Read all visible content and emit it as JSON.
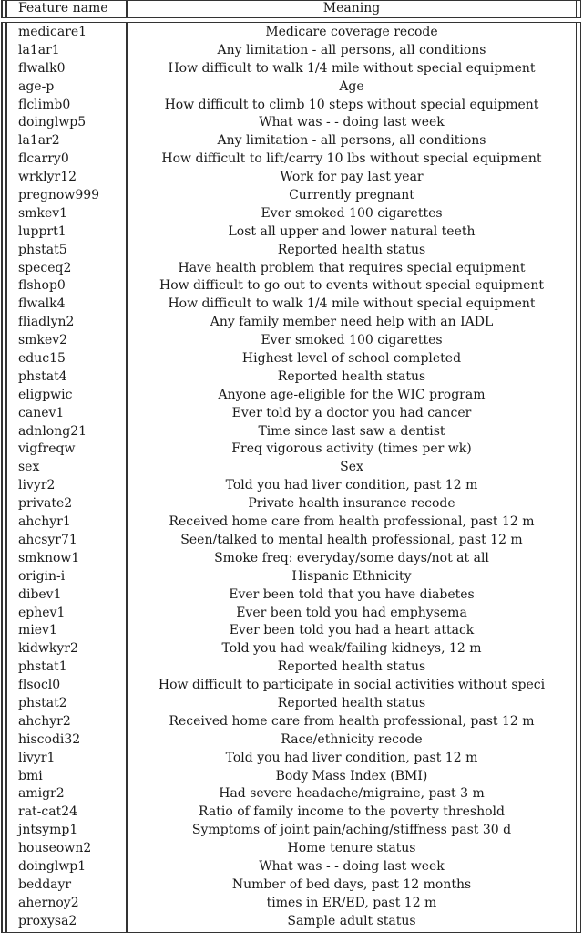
{
  "table": {
    "headers": {
      "feature_name": "Feature name",
      "meaning": "Meaning"
    },
    "rows": [
      {
        "name": "medicare1",
        "meaning": "Medicare coverage recode"
      },
      {
        "name": "la1ar1",
        "meaning": "Any limitation - all persons, all conditions"
      },
      {
        "name": "flwalk0",
        "meaning": "How difficult to walk 1/4 mile without special equipment"
      },
      {
        "name": "age-p",
        "meaning": "Age"
      },
      {
        "name": "flclimb0",
        "meaning": "How difficult to climb 10 steps without special equipment"
      },
      {
        "name": "doinglwp5",
        "meaning": "What was - - doing last week"
      },
      {
        "name": "la1ar2",
        "meaning": "Any limitation - all persons, all conditions"
      },
      {
        "name": "flcarry0",
        "meaning": "How difficult to lift/carry 10 lbs without special equipment"
      },
      {
        "name": "wrklyr12",
        "meaning": "Work for pay last year"
      },
      {
        "name": "pregnow999",
        "meaning": "Currently pregnant"
      },
      {
        "name": "smkev1",
        "meaning": "Ever smoked 100 cigarettes"
      },
      {
        "name": "lupprt1",
        "meaning": "Lost all upper and lower natural teeth"
      },
      {
        "name": "phstat5",
        "meaning": "Reported health status"
      },
      {
        "name": "speceq2",
        "meaning": "Have health problem that requires special equipment"
      },
      {
        "name": "flshop0",
        "meaning": "How difficult to go out to events without special equipment"
      },
      {
        "name": "flwalk4",
        "meaning": "How difficult to walk 1/4 mile without special equipment"
      },
      {
        "name": "fliadlyn2",
        "meaning": "Any family member need help with an IADL"
      },
      {
        "name": "smkev2",
        "meaning": "Ever smoked 100 cigarettes"
      },
      {
        "name": "educ15",
        "meaning": "Highest level of school completed"
      },
      {
        "name": "phstat4",
        "meaning": "Reported health status"
      },
      {
        "name": "eligpwic",
        "meaning": "Anyone age-eligible for the WIC program"
      },
      {
        "name": "canev1",
        "meaning": "Ever told by a doctor you had cancer"
      },
      {
        "name": "adnlong21",
        "meaning": "Time since last saw a dentist"
      },
      {
        "name": "vigfreqw",
        "meaning": "Freq vigorous activity (times per wk)"
      },
      {
        "name": "sex",
        "meaning": "Sex"
      },
      {
        "name": "livyr2",
        "meaning": "Told you had liver condition, past 12 m"
      },
      {
        "name": "private2",
        "meaning": "Private health insurance recode"
      },
      {
        "name": "ahchyr1",
        "meaning": "Received home care from health professional, past 12 m"
      },
      {
        "name": "ahcsyr71",
        "meaning": "Seen/talked to mental health professional, past 12 m"
      },
      {
        "name": "smknow1",
        "meaning": "Smoke freq: everyday/some days/not at all"
      },
      {
        "name": "origin-i",
        "meaning": "Hispanic Ethnicity"
      },
      {
        "name": "dibev1",
        "meaning": "Ever been told that you have diabetes"
      },
      {
        "name": "ephev1",
        "meaning": "Ever been told you had emphysema"
      },
      {
        "name": "miev1",
        "meaning": "Ever been told you had a heart attack"
      },
      {
        "name": "kidwkyr2",
        "meaning": "Told you had weak/failing kidneys, 12 m"
      },
      {
        "name": "phstat1",
        "meaning": "Reported health status"
      },
      {
        "name": "flsocl0",
        "meaning": "How difficult to participate in social activities without speci"
      },
      {
        "name": "phstat2",
        "meaning": "Reported health status"
      },
      {
        "name": "ahchyr2",
        "meaning": "Received home care from health professional, past 12 m"
      },
      {
        "name": "hiscodi32",
        "meaning": "Race/ethnicity recode"
      },
      {
        "name": "livyr1",
        "meaning": "Told you had liver condition, past 12 m"
      },
      {
        "name": "bmi",
        "meaning": "Body Mass Index (BMI)"
      },
      {
        "name": "amigr2",
        "meaning": "Had severe headache/migraine, past 3 m"
      },
      {
        "name": "rat-cat24",
        "meaning": "Ratio of family income to the poverty threshold"
      },
      {
        "name": "jntsymp1",
        "meaning": "Symptoms of joint pain/aching/stiffness past 30 d"
      },
      {
        "name": "houseown2",
        "meaning": "Home tenure status"
      },
      {
        "name": "doinglwp1",
        "meaning": "What was - - doing last week"
      },
      {
        "name": "beddayr",
        "meaning": "Number of bed days, past 12 months"
      },
      {
        "name": "ahernoy2",
        "meaning": "times in ER/ED, past 12 m"
      },
      {
        "name": "proxysa2",
        "meaning": "Sample adult status"
      }
    ]
  }
}
